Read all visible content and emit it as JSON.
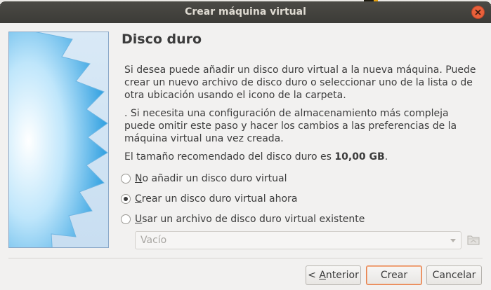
{
  "window": {
    "title": "Crear máquina virtual"
  },
  "page": {
    "heading": "Disco duro",
    "paragraph1": "Si desea puede añadir un disco duro virtual a la nueva máquina. Puede crear un nuevo archivo de disco duro o seleccionar uno de la lista o de otra ubicación usando el icono de la carpeta.",
    "paragraph2": ". Si necesita una configuración de almacenamiento más compleja puede omitir este paso y hacer los cambios a las preferencias de la máquina virtual una vez creada.",
    "recommended_prefix": "El tamaño recomendado del disco duro es ",
    "recommended_size": "10,00 GB",
    "recommended_suffix": "."
  },
  "options": [
    {
      "mnemonic": "N",
      "rest": "o añadir un disco duro virtual",
      "checked": false
    },
    {
      "mnemonic": "C",
      "rest": "rear un disco duro virtual ahora",
      "checked": true
    },
    {
      "mnemonic": "U",
      "rest": "sar un archivo de disco duro virtual existente",
      "checked": false
    }
  ],
  "disk_select": {
    "value": "Vacío"
  },
  "icons": {
    "close": "close-icon",
    "folder": "folder-icon",
    "dropdown": "chevron-down-icon"
  },
  "buttons": {
    "back_prefix": "< ",
    "back_mnemonic": "A",
    "back_rest": "nterior",
    "create": "Crear",
    "cancel": "Cancelar"
  },
  "colors": {
    "titlebar": "#3c3b37",
    "close": "#e9603a",
    "accent": "#e67e4a",
    "dialog_bg": "#f2f1f0"
  }
}
